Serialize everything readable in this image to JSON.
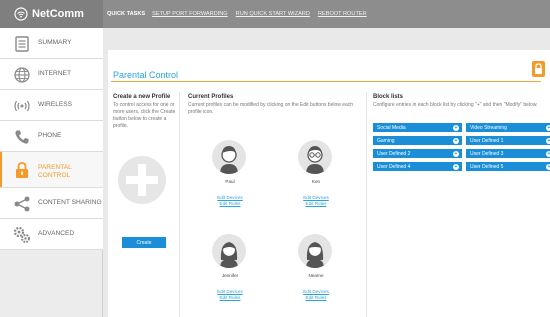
{
  "brand": {
    "name": "NetComm",
    "icon": "wifi-icon"
  },
  "quick_tasks": {
    "label": "QUICK TASKS",
    "links": [
      "SETUP PORT FORWARDING",
      "RUN QUICK START WIZARD",
      "REBOOT ROUTER"
    ]
  },
  "sidebar": {
    "items": [
      {
        "label": "SUMMARY",
        "icon": "document-icon"
      },
      {
        "label": "INTERNET",
        "icon": "globe-icon"
      },
      {
        "label": "WIRELESS",
        "icon": "wireless-icon"
      },
      {
        "label": "PHONE",
        "icon": "phone-icon"
      },
      {
        "label": "PARENTAL\nCONTROL",
        "label_line1": "PARENTAL",
        "label_line2": "CONTROL",
        "icon": "lock-icon",
        "active": true
      },
      {
        "label": "CONTENT SHARING",
        "icon": "share-icon"
      },
      {
        "label": "ADVANCED",
        "icon": "gears-icon"
      }
    ]
  },
  "page": {
    "title": "Parental Control",
    "accent": "#2aa3dc",
    "orange": "#f49a2a",
    "button_blue": "#1a8fd8"
  },
  "create": {
    "heading": "Create a new Profile",
    "desc": "To control access for one or more users, click the Create button below to create a profile.",
    "button": "Create"
  },
  "profiles": {
    "heading": "Current Profiles",
    "desc": "Current profiles can be modified by clicking on the Edit buttons below each profile icon.",
    "edit_devices": "Edit Devices",
    "edit_rules": "Edit Rules",
    "items": [
      {
        "name": "Paul",
        "avatar": "male-avatar-icon"
      },
      {
        "name": "Ken",
        "avatar": "male-glasses-avatar-icon"
      },
      {
        "name": "Jennifer",
        "avatar": "female-avatar-icon"
      },
      {
        "name": "Nearne",
        "avatar": "female-avatar-icon"
      }
    ]
  },
  "blocklists": {
    "heading": "Block lists",
    "desc": "Configure entries in each block list by clicking \"+\" and then \"Modify\" below.",
    "items": [
      "Social Media",
      "Video Streaming",
      "Gaming",
      "User Defined 1",
      "User Defined 2",
      "User Defined 3",
      "User Defined 4",
      "User Defined 5"
    ]
  }
}
